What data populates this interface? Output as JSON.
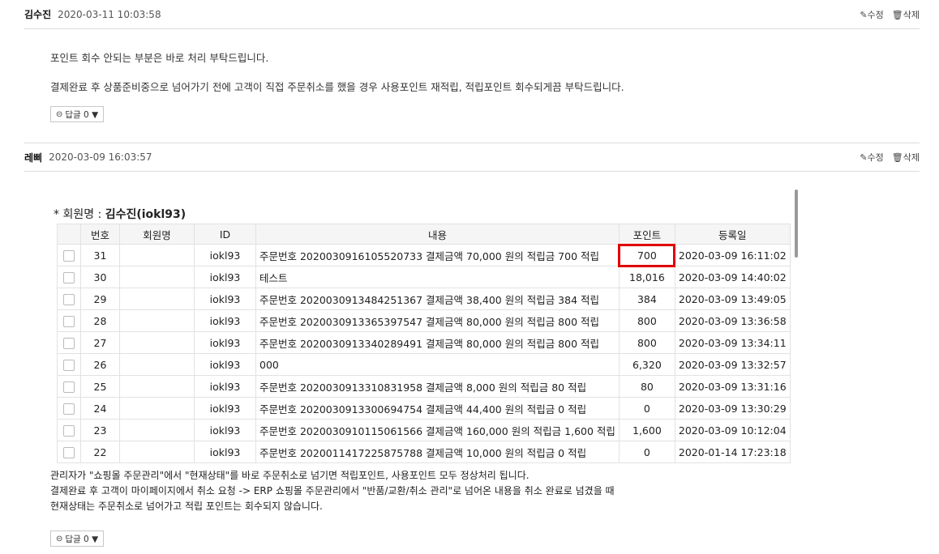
{
  "comments": [
    {
      "author": "김수진",
      "date": "2020-03-11 10:03:58",
      "edit_label": "✎수정",
      "delete_label": "🗑삭제",
      "lines": [
        "포인트 회수 안되는 부분은 바로 처리 부탁드립니다.",
        "결제완료 후 상품준비중으로 넘어가기 전에 고객이 직접 주문취소를 했을 경우 사용포인트 재적립, 적립포인트 회수되게끔 부탁드립니다."
      ],
      "reply_label": "답글 0 ▼"
    },
    {
      "author": "레삐",
      "date": "2020-03-09 16:03:57",
      "edit_label": "✎수정",
      "delete_label": "🗑삭제",
      "lines": [
        "관리자가 \"쇼핑몰 주문관리\"에서 \"현재상태\"를 바로 주문취소로 넘기면 적립포인트, 사용포인트 모두 정상처리 됩니다.",
        "결제완료 후 고객이 마이페이지에서 취소 요청 -> ERP 쇼핑몰 주문관리에서 \"반품/교환/취소 관리\"로 넘어온 내용을 취소 완료로 넘겼을 때",
        "현재상태는 주문취소로 넘어가고 적립 포인트는 회수되지 않습니다."
      ],
      "reply_label": "답글 0 ▼"
    }
  ],
  "embed": {
    "member_prefix": "* 회원명 : ",
    "member_name": "김수진(iokl93)",
    "columns": [
      "",
      "번호",
      "회원명",
      "ID",
      "내용",
      "포인트",
      "등록일"
    ],
    "rows": [
      {
        "no": "31",
        "name": "",
        "id": "iokl93",
        "content": "주문번호 2020030916105520733 결제금액 70,000 원의 적립금 700 적립",
        "point": "700",
        "date": "2020-03-09 16:11:02",
        "highlight": true
      },
      {
        "no": "30",
        "name": "",
        "id": "iokl93",
        "content": "테스트",
        "point": "18,016",
        "date": "2020-03-09 14:40:02"
      },
      {
        "no": "29",
        "name": "",
        "id": "iokl93",
        "content": "주문번호 2020030913484251367 결제금액 38,400 원의 적립금 384 적립",
        "point": "384",
        "date": "2020-03-09 13:49:05"
      },
      {
        "no": "28",
        "name": "",
        "id": "iokl93",
        "content": "주문번호 2020030913365397547 결제금액 80,000 원의 적립금 800 적립",
        "point": "800",
        "date": "2020-03-09 13:36:58"
      },
      {
        "no": "27",
        "name": "",
        "id": "iokl93",
        "content": "주문번호 2020030913340289491 결제금액 80,000 원의 적립금 800 적립",
        "point": "800",
        "date": "2020-03-09 13:34:11"
      },
      {
        "no": "26",
        "name": "",
        "id": "iokl93",
        "content": "000",
        "point": "6,320",
        "date": "2020-03-09 13:32:57"
      },
      {
        "no": "25",
        "name": "",
        "id": "iokl93",
        "content": "주문번호 2020030913310831958 결제금액 8,000 원의 적립금 80 적립",
        "point": "80",
        "date": "2020-03-09 13:31:16"
      },
      {
        "no": "24",
        "name": "",
        "id": "iokl93",
        "content": "주문번호 2020030913300694754 결제금액 44,400 원의 적립금 0 적립",
        "point": "0",
        "date": "2020-03-09 13:30:29"
      },
      {
        "no": "23",
        "name": "",
        "id": "iokl93",
        "content": "주문번호 2020030910115061566 결제금액 160,000 원의 적립금 1,600 적립",
        "point": "1,600",
        "date": "2020-03-09 10:12:04"
      },
      {
        "no": "22",
        "name": "",
        "id": "iokl93",
        "content": "주문번호 2020011417225875788 결제금액 10,000 원의 적립금 0 적립",
        "point": "0",
        "date": "2020-01-14 17:23:18"
      }
    ]
  }
}
